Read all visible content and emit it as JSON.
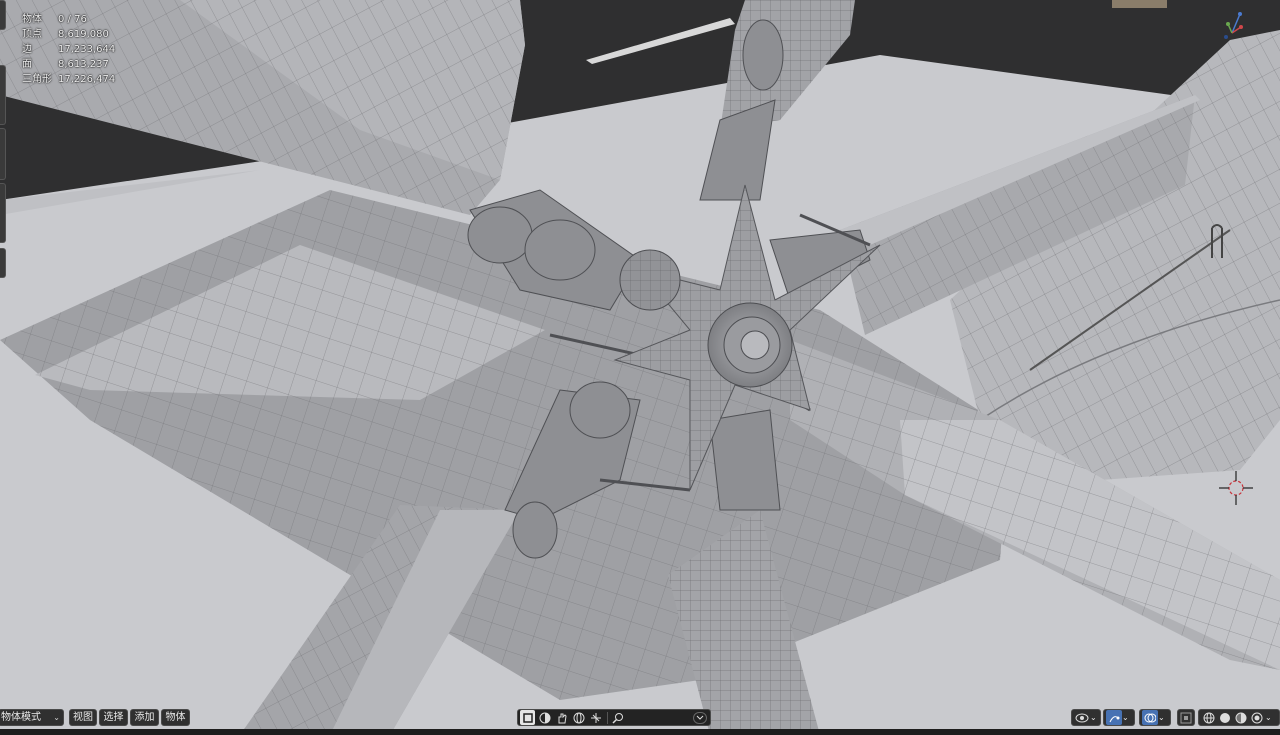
{
  "stats": {
    "rows": [
      {
        "label": "物体",
        "value": "0 / 76"
      },
      {
        "label": "顶点",
        "value": "8,619,080"
      },
      {
        "label": "边",
        "value": "17,233,644"
      },
      {
        "label": "面",
        "value": "8,613,237"
      },
      {
        "label": "三角形",
        "value": "17,226,474"
      }
    ]
  },
  "header": {
    "mode_label": "物体模式",
    "menus": [
      "视图",
      "选择",
      "添加",
      "物体"
    ]
  },
  "toolbar_icons": [
    "select-box-icon",
    "material-preview-icon",
    "hand-icon",
    "sphere-icon",
    "transform-icon",
    "search-icon"
  ],
  "right_icons": [
    "eye-icon",
    "gizmo-icon",
    "overlay-icon",
    "xray-icon",
    "wireframe-shading-icon",
    "solid-shading-icon",
    "material-shading-icon",
    "rendered-shading-icon"
  ],
  "colors": {
    "viewport_bg": "#2e2e2e",
    "ground": "#c8c9cd",
    "mesh": "#9c9da1",
    "accent": "#4772b3"
  }
}
